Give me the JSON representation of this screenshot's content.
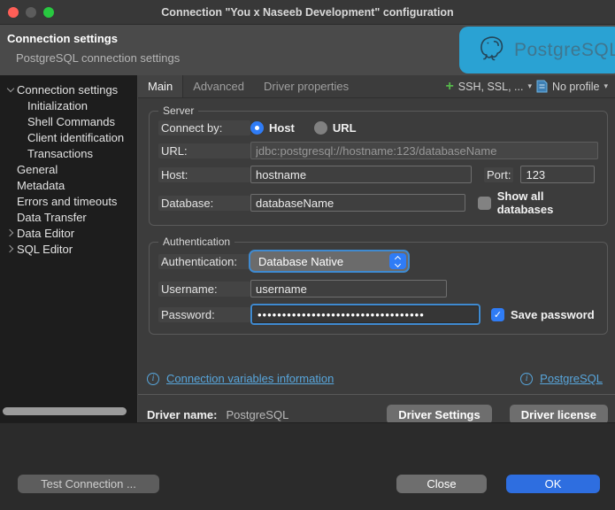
{
  "window": {
    "title": "Connection \"You x Naseeb Development\" configuration"
  },
  "header": {
    "title": "Connection settings",
    "subtitle": "PostgreSQL connection settings",
    "badge_text": "PostgreSQL",
    "badge_color": "#2aa2d3"
  },
  "sidebar": {
    "items": [
      {
        "label": "Connection settings",
        "level": 0,
        "chevron": "down"
      },
      {
        "label": "Initialization",
        "level": 1,
        "chevron": "none"
      },
      {
        "label": "Shell Commands",
        "level": 1,
        "chevron": "none"
      },
      {
        "label": "Client identification",
        "level": 1,
        "chevron": "none"
      },
      {
        "label": "Transactions",
        "level": 1,
        "chevron": "none"
      },
      {
        "label": "General",
        "level": 0,
        "chevron": "none"
      },
      {
        "label": "Metadata",
        "level": 0,
        "chevron": "none"
      },
      {
        "label": "Errors and timeouts",
        "level": 0,
        "chevron": "none"
      },
      {
        "label": "Data Transfer",
        "level": 0,
        "chevron": "none"
      },
      {
        "label": "Data Editor",
        "level": 0,
        "chevron": "right"
      },
      {
        "label": "SQL Editor",
        "level": 0,
        "chevron": "right"
      }
    ]
  },
  "tabs": {
    "main": "Main",
    "advanced": "Advanced",
    "driver_properties": "Driver properties",
    "ssh_ssl": "SSH, SSL, ...",
    "no_profile": "No profile"
  },
  "server": {
    "legend": "Server",
    "connect_by_label": "Connect by:",
    "host_radio": "Host",
    "url_radio": "URL",
    "url_label": "URL:",
    "url_value": "jdbc:postgresql://hostname:123/databaseName",
    "host_label": "Host:",
    "host_value": "hostname",
    "port_label": "Port:",
    "port_value": "123",
    "database_label": "Database:",
    "database_value": "databaseName",
    "show_all_label": "Show all databases"
  },
  "auth": {
    "legend": "Authentication",
    "auth_label": "Authentication:",
    "auth_value": "Database Native",
    "username_label": "Username:",
    "username_value": "username",
    "password_label": "Password:",
    "password_masked": "••••••••••••••••••••••••••••••••••",
    "save_password_label": "Save password"
  },
  "links": {
    "variables": "Connection variables information",
    "driver_site": "PostgreSQL"
  },
  "driver": {
    "label": "Driver name:",
    "value": "PostgreSQL",
    "settings_button": "Driver Settings",
    "license_button": "Driver license"
  },
  "footer": {
    "test_button": "Test Connection ...",
    "close_button": "Close",
    "ok_button": "OK"
  },
  "icons": {
    "plus": "+",
    "dropdown_arrow": "▾",
    "check": "✓",
    "info": "i"
  },
  "colors": {
    "accent_blue": "#2f7cf6",
    "ok_button": "#2e6ee0",
    "link": "#58a6dc",
    "badge": "#2aa2d3",
    "focus_ring": "#3f8ad0"
  }
}
